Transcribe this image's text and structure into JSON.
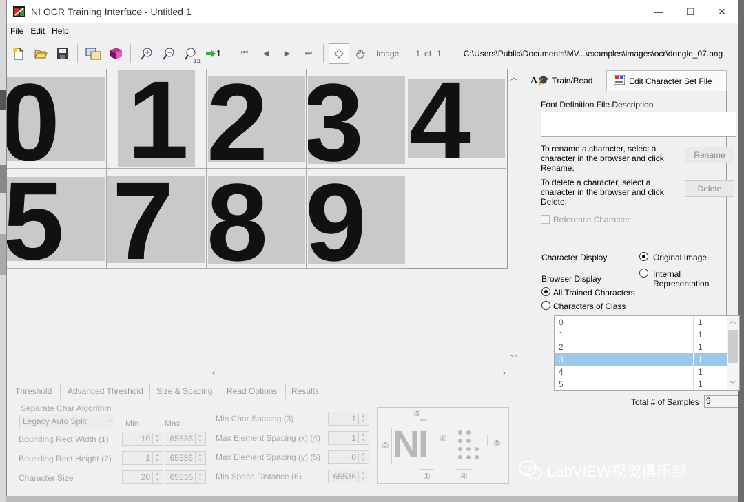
{
  "window": {
    "title": "NI OCR Training Interface - Untitled 1",
    "minimize": "—",
    "maximize": "☐",
    "close": "✕"
  },
  "menu": [
    "File",
    "Edit",
    "Help"
  ],
  "toolbar": {
    "image_label": "Image",
    "image_index": "1",
    "of_label": "of",
    "image_total": "1",
    "file_path": "C:\\Users\\Public\\Documents\\MV...\\examples\\images\\ocr\\dongle_07.png",
    "zoom_1to1": "1:1",
    "goto_label": "1"
  },
  "characters": [
    "0",
    "1",
    "2",
    "3",
    "4",
    "5",
    "7",
    "8",
    "9"
  ],
  "right_panel": {
    "tab_train": "Train/Read",
    "tab_edit": "Edit Character Set File",
    "font_desc_label": "Font Definition File Description",
    "font_desc_value": "",
    "rename_text": "To rename a character, select a character in the browser and click Rename.",
    "rename_button": "Rename",
    "delete_text": "To delete a character, select a character in the browser and click Delete.",
    "delete_button": "Delete",
    "reference_checkbox": "Reference Character",
    "char_display_label": "Character Display",
    "opt_original": "Original Image",
    "opt_internal": "Internal Representation",
    "browser_display_label": "Browser Display",
    "opt_all_trained": "All Trained Characters",
    "opt_chars_of_class": "Characters of Class",
    "list": [
      {
        "char": "0",
        "count": "1"
      },
      {
        "char": "1",
        "count": "1"
      },
      {
        "char": "2",
        "count": "1"
      },
      {
        "char": "3",
        "count": "1",
        "selected": true
      },
      {
        "char": "4",
        "count": "1"
      },
      {
        "char": "5",
        "count": "1"
      }
    ],
    "total_label": "Total # of Samples",
    "total_value": "9"
  },
  "bottom_tabs": [
    "Threshold",
    "Advanced Threshold",
    "Size & Spacing",
    "Read Options",
    "Results"
  ],
  "size_spacing": {
    "separate_algo_label": "Separate Char Algorithm",
    "separate_algo_value": "Legacy Auto Split",
    "min_header": "Min",
    "max_header": "Max",
    "rows": [
      {
        "label": "Bounding Rect Width (1)",
        "min": "10",
        "max": "65536"
      },
      {
        "label": "Bounding Rect Height (2)",
        "min": "1",
        "max": "65536"
      },
      {
        "label": "Character Size",
        "min": "20",
        "max": "65536"
      }
    ],
    "right_rows": [
      {
        "label": "Min Char Spacing (3)",
        "value": "1"
      },
      {
        "label": "Max Element Spacing (x) (4)",
        "value": "1"
      },
      {
        "label": "Max Element Spacing (y) (5)",
        "value": "0"
      },
      {
        "label": "Min Space Distance (6)",
        "value": "65536"
      }
    ],
    "diagram_text": "NI",
    "diagram_marks": [
      "①",
      "②",
      "③",
      "④",
      "⑤",
      "⑥"
    ]
  },
  "watermark": "LabVIEW视觉俱乐部",
  "colors": {
    "selection": "#99c9ef",
    "panel_bg": "#f0f0f0",
    "image_bg": "#c9c9c9"
  }
}
